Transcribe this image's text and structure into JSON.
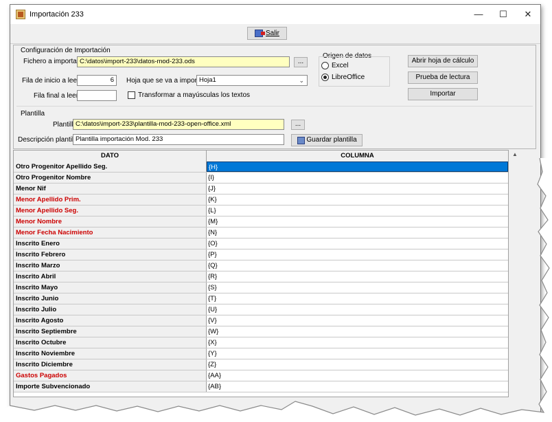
{
  "window": {
    "title": "Importación 233",
    "minimize": "—",
    "maximize": "☐",
    "close": "✕"
  },
  "toolbar": {
    "salir_label": "Salir"
  },
  "config": {
    "section_title": "Configuración de Importación",
    "file_label": "Fichero a importar:",
    "file_value": "C:\\datos\\import-233\\datos-mod-233.ods",
    "browse_label": "...",
    "start_row_label": "Fila de inicio a leer:",
    "start_row_value": "6",
    "end_row_label": "Fila final a leer:",
    "end_row_value": "",
    "sheet_label": "Hoja que se va a importar",
    "sheet_value": "Hoja1",
    "uppercase_label": "Transformar a mayúsculas los textos",
    "source_title": "Origen de datos",
    "source_excel": "Excel",
    "source_libreoffice": "LibreOffice",
    "source_selected": "LibreOffice",
    "open_sheet_button": "Abrir hoja de cálculo",
    "test_read_button": "Prueba de lectura",
    "import_button": "Importar"
  },
  "template": {
    "section_title": "Plantilla",
    "template_label": "Plantilla:",
    "template_value": "C:\\datos\\import-233\\plantilla-mod-233-open-office.xml",
    "browse_label": "...",
    "description_label": "Descripción plantilla",
    "description_value": "Plantilla importación Mod. 233",
    "save_button": "Guardar plantilla"
  },
  "grid": {
    "headers": [
      "DATO",
      "COLUMNA"
    ],
    "rows": [
      {
        "dato": "Otro Progenitor Apellido Seg.",
        "columna": "{H}",
        "red": false
      },
      {
        "dato": "Otro Progenitor Nombre",
        "columna": "{I}",
        "red": false
      },
      {
        "dato": "Menor Nif",
        "columna": "{J}",
        "red": false
      },
      {
        "dato": "Menor Apellido Prim.",
        "columna": "{K}",
        "red": true
      },
      {
        "dato": "Menor Apellido Seg.",
        "columna": "{L}",
        "red": true
      },
      {
        "dato": "Menor Nombre",
        "columna": "{M}",
        "red": true
      },
      {
        "dato": "Menor Fecha Nacimiento",
        "columna": "{N}",
        "red": true
      },
      {
        "dato": "Inscrito Enero",
        "columna": "{O}",
        "red": false
      },
      {
        "dato": "Inscrito Febrero",
        "columna": "{P}",
        "red": false
      },
      {
        "dato": "Inscrito Marzo",
        "columna": "{Q}",
        "red": false
      },
      {
        "dato": "Inscrito Abril",
        "columna": "{R}",
        "red": false
      },
      {
        "dato": "Inscrito Mayo",
        "columna": "{S}",
        "red": false
      },
      {
        "dato": "Inscrito Junio",
        "columna": "{T}",
        "red": false
      },
      {
        "dato": "Inscrito Julio",
        "columna": "{U}",
        "red": false
      },
      {
        "dato": "Inscrito Agosto",
        "columna": "{V}",
        "red": false
      },
      {
        "dato": "Inscrito Septiembre",
        "columna": "{W}",
        "red": false
      },
      {
        "dato": "Inscrito Octubre",
        "columna": "{X}",
        "red": false
      },
      {
        "dato": "Inscrito Noviembre",
        "columna": "{Y}",
        "red": false
      },
      {
        "dato": "Inscrito Diciembre",
        "columna": "{Z}",
        "red": false
      },
      {
        "dato": "Gastos Pagados",
        "columna": "{AA}",
        "red": true
      },
      {
        "dato": "Importe Subvencionado",
        "columna": "{AB}",
        "red": false
      }
    ],
    "selected_row": 0
  },
  "colors": {
    "selection": "#0078d7",
    "required": "#cc0000",
    "field_yellow": "#ffffc0"
  }
}
